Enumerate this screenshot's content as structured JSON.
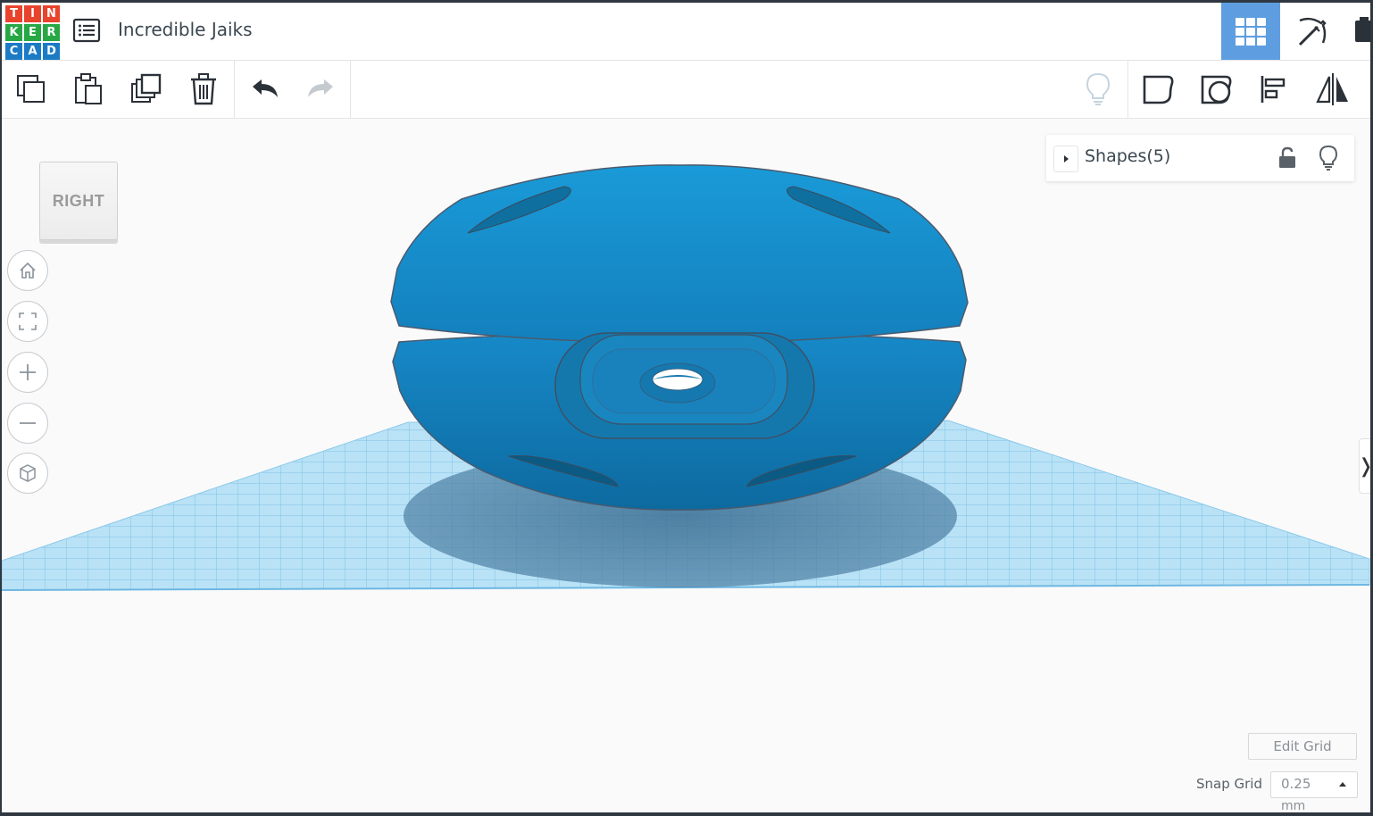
{
  "app": {
    "logo_letters": [
      "T",
      "I",
      "N",
      "K",
      "E",
      "R",
      "C",
      "A",
      "D"
    ],
    "logo_colors": [
      "#e8442d",
      "#e8442d",
      "#e8442d",
      "#27a844",
      "#27a844",
      "#27a844",
      "#1c7bc5",
      "#1c7bc5",
      "#1c7bc5"
    ],
    "document_title": "Incredible Jaiks"
  },
  "header": {
    "icons": [
      "menu-list-icon",
      "grid-view-icon",
      "pickaxe-icon",
      "blocks-icon"
    ],
    "active_view": "grid-view"
  },
  "toolbar": {
    "left_icons": [
      "copy-icon",
      "paste-icon",
      "duplicate-icon",
      "trash-icon",
      "undo-icon",
      "redo-icon"
    ],
    "right_icons": [
      "lightbulb-icon",
      "solid-shape-icon",
      "hole-shape-icon",
      "align-icon",
      "mirror-icon"
    ]
  },
  "view_cube": {
    "label": "RIGHT"
  },
  "nav_controls": [
    "home-view-icon",
    "fit-view-icon",
    "zoom-in-icon",
    "zoom-out-icon",
    "perspective-icon"
  ],
  "shapes_panel": {
    "label": "Shapes(5)"
  },
  "grid_controls": {
    "edit_grid_label": "Edit Grid",
    "snap_grid_label": "Snap Grid",
    "snap_value": "0.25",
    "snap_unit": "mm"
  },
  "colors": {
    "accent": "#5e9ee0",
    "shape_fill": "#1489c9",
    "workplane_grid": "#7ec3e8"
  }
}
